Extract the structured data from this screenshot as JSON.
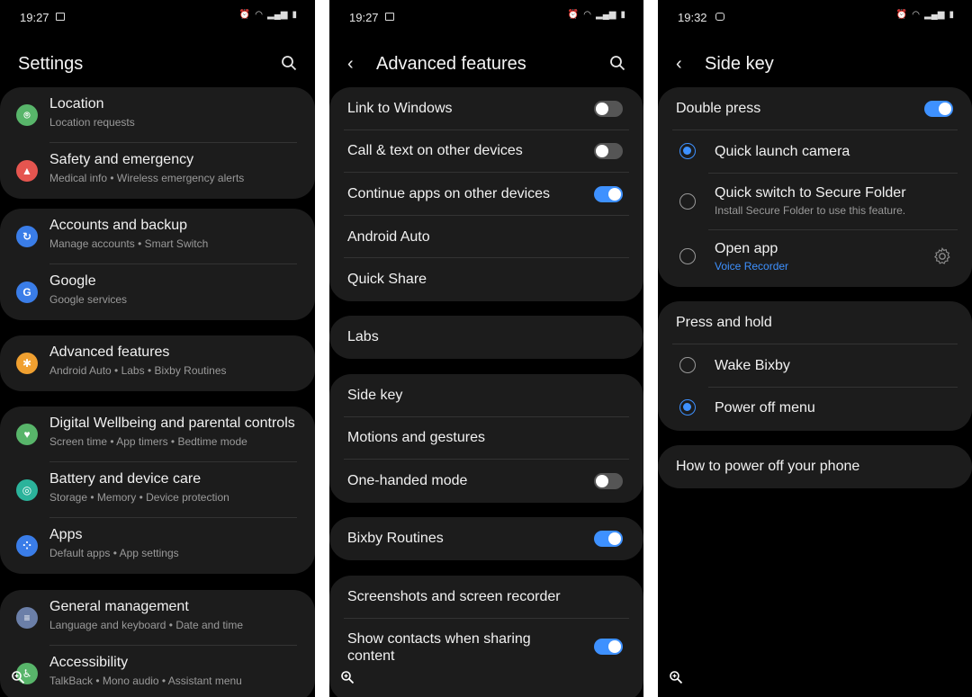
{
  "settings": {
    "status_time": "19:27",
    "title": "Settings",
    "groups": [
      [
        {
          "title": "Location",
          "sub": "Location requests",
          "icon": "location-icon",
          "color": "#58b56a"
        },
        {
          "title": "Safety and emergency",
          "sub": "Medical info  •  Wireless emergency alerts",
          "icon": "siren-icon",
          "color": "#e5554f"
        }
      ],
      [
        {
          "title": "Accounts and backup",
          "sub": "Manage accounts  •  Smart Switch",
          "icon": "sync-icon",
          "color": "#3a7de8"
        },
        {
          "title": "Google",
          "sub": "Google services",
          "icon": "google-icon",
          "color": "#3a7de8"
        }
      ],
      [
        {
          "title": "Advanced features",
          "sub": "Android Auto  •  Labs  •  Bixby Routines",
          "icon": "star-gear-icon",
          "color": "#f0a030"
        }
      ],
      [
        {
          "title": "Digital Wellbeing and parental controls",
          "sub": "Screen time  •  App timers  •  Bedtime mode",
          "icon": "wellbeing-icon",
          "color": "#58b56a"
        },
        {
          "title": "Battery and device care",
          "sub": "Storage  •  Memory  •  Device protection",
          "icon": "battery-care-icon",
          "color": "#2bb39b"
        },
        {
          "title": "Apps",
          "sub": "Default apps  •  App settings",
          "icon": "apps-icon",
          "color": "#3a7de8"
        }
      ],
      [
        {
          "title": "General management",
          "sub": "Language and keyboard  •  Date and time",
          "icon": "sliders-icon",
          "color": "#6b7fa8"
        },
        {
          "title": "Accessibility",
          "sub": "TalkBack  •  Mono audio  •  Assistant menu",
          "icon": "accessibility-icon",
          "color": "#58b56a"
        }
      ]
    ]
  },
  "advanced": {
    "status_time": "19:27",
    "title": "Advanced features",
    "groups": [
      [
        {
          "title": "Link to Windows",
          "toggle": "off"
        },
        {
          "title": "Call & text on other devices",
          "toggle": "off"
        },
        {
          "title": "Continue apps on other devices",
          "toggle": "on"
        },
        {
          "title": "Android Auto"
        },
        {
          "title": "Quick Share"
        }
      ],
      [
        {
          "title": "Labs"
        }
      ],
      [
        {
          "title": "Side key"
        },
        {
          "title": "Motions and gestures"
        },
        {
          "title": "One-handed mode",
          "toggle": "off"
        }
      ],
      [
        {
          "title": "Bixby Routines",
          "toggle": "on"
        }
      ],
      [
        {
          "title": "Screenshots and screen recorder"
        },
        {
          "title": "Show contacts when sharing content",
          "toggle": "on"
        }
      ]
    ],
    "two_line_first": "Show contacts when sharing",
    "two_line_second": "content"
  },
  "sidekey": {
    "status_time": "19:32",
    "title": "Side key",
    "double_press": {
      "label": "Double press",
      "toggle": "on"
    },
    "double_options": [
      {
        "title": "Quick launch camera",
        "selected": true
      },
      {
        "title": "Quick switch to Secure Folder",
        "sub": "Install Secure Folder to use this feature.",
        "selected": false
      },
      {
        "title": "Open app",
        "sub": "Voice Recorder",
        "selected": false
      }
    ],
    "press_hold": {
      "label": "Press and hold"
    },
    "hold_options": [
      {
        "title": "Wake Bixby",
        "selected": false
      },
      {
        "title": "Power off menu",
        "selected": true
      }
    ],
    "how_to": "How to power off your phone"
  },
  "status_icons": {
    "network": "VoLTE LTE1",
    "colors": {
      "accent": "#3e91ff",
      "card": "#1c1c1c"
    }
  }
}
